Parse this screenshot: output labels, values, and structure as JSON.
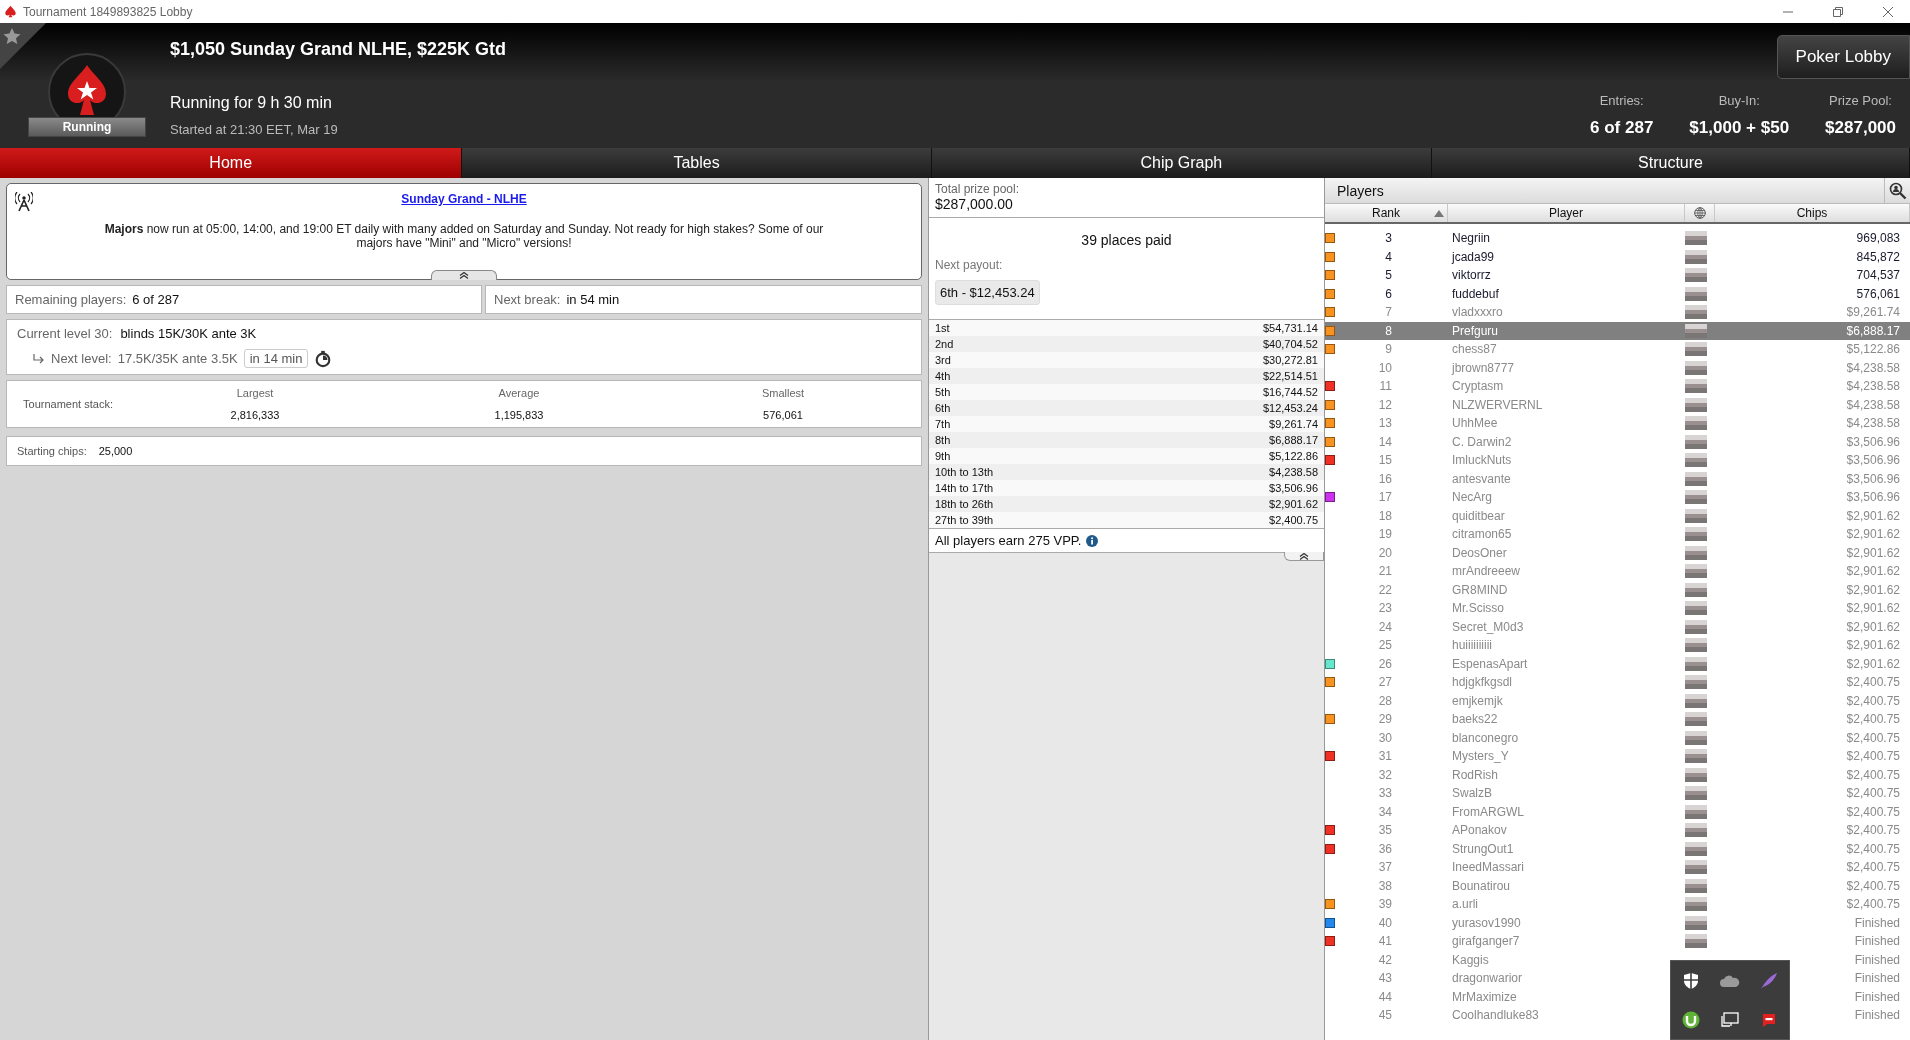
{
  "window": {
    "title": "Tournament 1849893825 Lobby"
  },
  "header": {
    "status_badge": "Running",
    "title": "$1,050 Sunday Grand NLHE, $225K Gtd",
    "running_for": "Running for 9 h 30 min",
    "started_at": "Started at 21:30 EET, Mar 19",
    "lobby_button": "Poker Lobby",
    "stats": [
      {
        "label": "Entries:",
        "value": "6 of 287"
      },
      {
        "label": "Buy-In:",
        "value": "$1,000 + $50"
      },
      {
        "label": "Prize Pool:",
        "value": "$287,000"
      }
    ]
  },
  "tabs": [
    {
      "label": "Home",
      "selected": true
    },
    {
      "label": "Tables",
      "selected": false
    },
    {
      "label": "Chip Graph",
      "selected": false
    },
    {
      "label": "Structure",
      "selected": false
    }
  ],
  "news": {
    "title": "Sunday Grand - NLHE",
    "text": "**Majors** now run at 05:00, 14:00, and 19:00 ET daily with many added on Saturday and Sunday. Not ready for high stakes? Some of our majors have \"Mini\" and \"Micro\" versions!"
  },
  "remaining_players": {
    "label": "Remaining players:",
    "value": "6 of 287"
  },
  "next_break": {
    "label": "Next break:",
    "value": "in 54 min"
  },
  "current_level": {
    "label": "Current level 30:",
    "value": "blinds 15K/30K ante 3K"
  },
  "next_level": {
    "label": "Next level:",
    "value": "17.5K/35K ante 3.5K",
    "time": "in 14 min"
  },
  "stack": {
    "label": "Tournament stack:",
    "columns": [
      {
        "label": "Largest",
        "value": "2,816,333"
      },
      {
        "label": "Average",
        "value": "1,195,833"
      },
      {
        "label": "Smallest",
        "value": "576,061"
      }
    ]
  },
  "starting_chips": {
    "label": "Starting chips:",
    "value": "25,000"
  },
  "prizes": {
    "pool_label": "Total prize pool:",
    "pool_value": "$287,000.00",
    "places_paid": "39 places paid",
    "next_payout_label": "Next payout:",
    "next_payout": "6th - $12,453.24",
    "payouts": [
      {
        "place": "1st",
        "amount": "$54,731.14"
      },
      {
        "place": "2nd",
        "amount": "$40,704.52"
      },
      {
        "place": "3rd",
        "amount": "$30,272.81"
      },
      {
        "place": "4th",
        "amount": "$22,514.51"
      },
      {
        "place": "5th",
        "amount": "$16,744.52"
      },
      {
        "place": "6th",
        "amount": "$12,453.24"
      },
      {
        "place": "7th",
        "amount": "$9,261.74"
      },
      {
        "place": "8th",
        "amount": "$6,888.17"
      },
      {
        "place": "9th",
        "amount": "$5,122.86"
      },
      {
        "place": "10th to 13th",
        "amount": "$4,238.58"
      },
      {
        "place": "14th to 17th",
        "amount": "$3,506.96"
      },
      {
        "place": "18th to 26th",
        "amount": "$2,901.62"
      },
      {
        "place": "27th to 39th",
        "amount": "$2,400.75"
      }
    ],
    "footer": "All players earn 275 VPP."
  },
  "players": {
    "title": "Players",
    "rank_header": "Rank",
    "player_header": "Player",
    "chips_header": "Chips",
    "rows": [
      {
        "rank": "3",
        "name": "Negriin",
        "chips": "969,083",
        "eliminated": false,
        "selected": false,
        "color": "#f7931e"
      },
      {
        "rank": "4",
        "name": "jcada99",
        "chips": "845,872",
        "eliminated": false,
        "selected": false,
        "color": "#f7931e"
      },
      {
        "rank": "5",
        "name": "viktorrz",
        "chips": "704,537",
        "eliminated": false,
        "selected": false,
        "color": "#f7931e"
      },
      {
        "rank": "6",
        "name": "fuddebuf",
        "chips": "576,061",
        "eliminated": false,
        "selected": false,
        "color": "#f7931e"
      },
      {
        "rank": "7",
        "name": "vladxxxro",
        "chips": "$9,261.74",
        "eliminated": true,
        "selected": false,
        "color": "#f7931e"
      },
      {
        "rank": "8",
        "name": "Prefguru",
        "chips": "$6,888.17",
        "eliminated": true,
        "selected": true,
        "color": "#f7931e"
      },
      {
        "rank": "9",
        "name": "chess87",
        "chips": "$5,122.86",
        "eliminated": true,
        "selected": false,
        "color": "#f7931e"
      },
      {
        "rank": "10",
        "name": "jbrown8777",
        "chips": "$4,238.58",
        "eliminated": true,
        "selected": false
      },
      {
        "rank": "11",
        "name": "Cryptasm",
        "chips": "$4,238.58",
        "eliminated": true,
        "selected": false,
        "color": "#ee3124"
      },
      {
        "rank": "12",
        "name": "NLZWERVERNL",
        "chips": "$4,238.58",
        "eliminated": true,
        "selected": false,
        "color": "#f7931e"
      },
      {
        "rank": "13",
        "name": "UhhMee",
        "chips": "$4,238.58",
        "eliminated": true,
        "selected": false,
        "color": "#f7931e"
      },
      {
        "rank": "14",
        "name": "C. Darwin2",
        "chips": "$3,506.96",
        "eliminated": true,
        "selected": false,
        "color": "#f7931e"
      },
      {
        "rank": "15",
        "name": "ImluckNuts",
        "chips": "$3,506.96",
        "eliminated": true,
        "selected": false,
        "color": "#ee3124"
      },
      {
        "rank": "16",
        "name": "antesvante",
        "chips": "$3,506.96",
        "eliminated": true,
        "selected": false
      },
      {
        "rank": "17",
        "name": "NecArg",
        "chips": "$3,506.96",
        "eliminated": true,
        "selected": false,
        "color": "#cc33ee"
      },
      {
        "rank": "18",
        "name": "quiditbear",
        "chips": "$2,901.62",
        "eliminated": true,
        "selected": false
      },
      {
        "rank": "19",
        "name": "citramon65",
        "chips": "$2,901.62",
        "eliminated": true,
        "selected": false
      },
      {
        "rank": "20",
        "name": "DeosOner",
        "chips": "$2,901.62",
        "eliminated": true,
        "selected": false
      },
      {
        "rank": "21",
        "name": "mrAndreeew",
        "chips": "$2,901.62",
        "eliminated": true,
        "selected": false
      },
      {
        "rank": "22",
        "name": "GR8MIND",
        "chips": "$2,901.62",
        "eliminated": true,
        "selected": false
      },
      {
        "rank": "23",
        "name": "Mr.Scisso",
        "chips": "$2,901.62",
        "eliminated": true,
        "selected": false
      },
      {
        "rank": "24",
        "name": "Secret_M0d3",
        "chips": "$2,901.62",
        "eliminated": true,
        "selected": false
      },
      {
        "rank": "25",
        "name": "huiiiiiiiiii",
        "chips": "$2,901.62",
        "eliminated": true,
        "selected": false
      },
      {
        "rank": "26",
        "name": "EspenasApart",
        "chips": "$2,901.62",
        "eliminated": true,
        "selected": false,
        "color": "#66e6cc"
      },
      {
        "rank": "27",
        "name": "hdjgkfkgsdl",
        "chips": "$2,400.75",
        "eliminated": true,
        "selected": false,
        "color": "#f7931e"
      },
      {
        "rank": "28",
        "name": "emjkemjk",
        "chips": "$2,400.75",
        "eliminated": true,
        "selected": false
      },
      {
        "rank": "29",
        "name": "baeks22",
        "chips": "$2,400.75",
        "eliminated": true,
        "selected": false,
        "color": "#f7931e"
      },
      {
        "rank": "30",
        "name": "blanconegro",
        "chips": "$2,400.75",
        "eliminated": true,
        "selected": false
      },
      {
        "rank": "31",
        "name": "Mysters_Y",
        "chips": "$2,400.75",
        "eliminated": true,
        "selected": false,
        "color": "#ee3124"
      },
      {
        "rank": "32",
        "name": "RodRish",
        "chips": "$2,400.75",
        "eliminated": true,
        "selected": false
      },
      {
        "rank": "33",
        "name": "SwalzB",
        "chips": "$2,400.75",
        "eliminated": true,
        "selected": false
      },
      {
        "rank": "34",
        "name": "FromARGWL",
        "chips": "$2,400.75",
        "eliminated": true,
        "selected": false
      },
      {
        "rank": "35",
        "name": "APonakov",
        "chips": "$2,400.75",
        "eliminated": true,
        "selected": false,
        "color": "#ee3124"
      },
      {
        "rank": "36",
        "name": "StrungOut1",
        "chips": "$2,400.75",
        "eliminated": true,
        "selected": false,
        "color": "#ee3124"
      },
      {
        "rank": "37",
        "name": "IneedMassari",
        "chips": "$2,400.75",
        "eliminated": true,
        "selected": false
      },
      {
        "rank": "38",
        "name": "Bounatirou",
        "chips": "$2,400.75",
        "eliminated": true,
        "selected": false
      },
      {
        "rank": "39",
        "name": "a.urli",
        "chips": "$2,400.75",
        "eliminated": true,
        "selected": false,
        "color": "#f7931e"
      },
      {
        "rank": "40",
        "name": "yurasov1990",
        "chips": "Finished",
        "eliminated": true,
        "selected": false,
        "color": "#2288ee"
      },
      {
        "rank": "41",
        "name": "girafganger7",
        "chips": "Finished",
        "eliminated": true,
        "selected": false,
        "color": "#ee3124"
      },
      {
        "rank": "42",
        "name": "Kaggis",
        "chips": "Finished",
        "eliminated": true,
        "selected": false
      },
      {
        "rank": "43",
        "name": "dragonwarior",
        "chips": "Finished",
        "eliminated": true,
        "selected": false
      },
      {
        "rank": "44",
        "name": "MrMaximize",
        "chips": "Finished",
        "eliminated": true,
        "selected": false
      },
      {
        "rank": "45",
        "name": "Coolhandluke83",
        "chips": "Finished",
        "eliminated": true,
        "selected": false
      }
    ]
  }
}
